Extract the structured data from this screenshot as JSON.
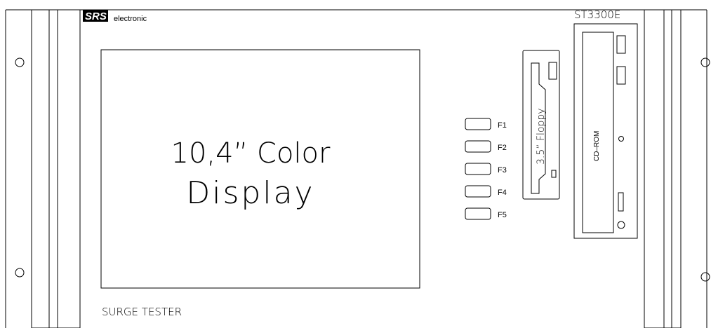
{
  "brand": {
    "logo_text": "SRS",
    "name": "electronic"
  },
  "model": "ST3300E",
  "display": {
    "line1": "10,4” Color",
    "line2": "Display"
  },
  "product_label": "SURGE TESTER",
  "function_keys": [
    "F1",
    "F2",
    "F3",
    "F4",
    "F5"
  ],
  "floppy_label": "3.5” Floppy",
  "cdrom_label": "CD–ROM"
}
